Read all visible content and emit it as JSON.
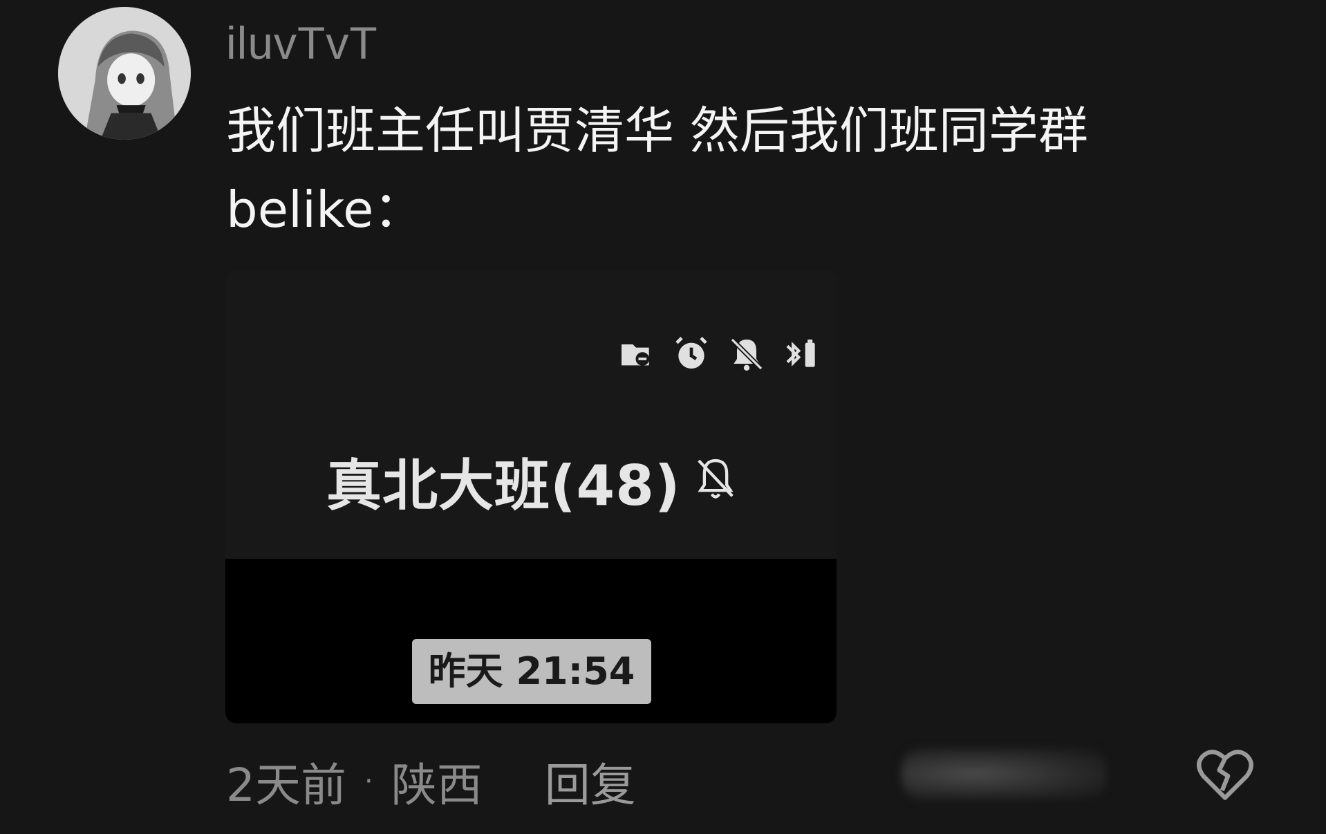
{
  "author": {
    "username": "iluvTvT",
    "avatar_icon": "anime-avatar"
  },
  "comment": {
    "text": "我们班主任叫贾清华 然后我们班同学群belike："
  },
  "screenshot": {
    "status_icons": [
      "sd-card-icon",
      "alarm-icon",
      "bell-off-icon",
      "bluetooth-icon"
    ],
    "group_title": "真北大班(48)",
    "mute_icon": "bell-muted-icon",
    "time_label": "昨天 21:54"
  },
  "footer": {
    "time_ago": "2天前",
    "separator": "·",
    "location": "陕西",
    "reply_label": "回复",
    "dislike_icon": "broken-heart-icon"
  },
  "colors": {
    "background": "#161616",
    "muted_text": "#8a8a8a",
    "chip": "#bdbdbd"
  }
}
